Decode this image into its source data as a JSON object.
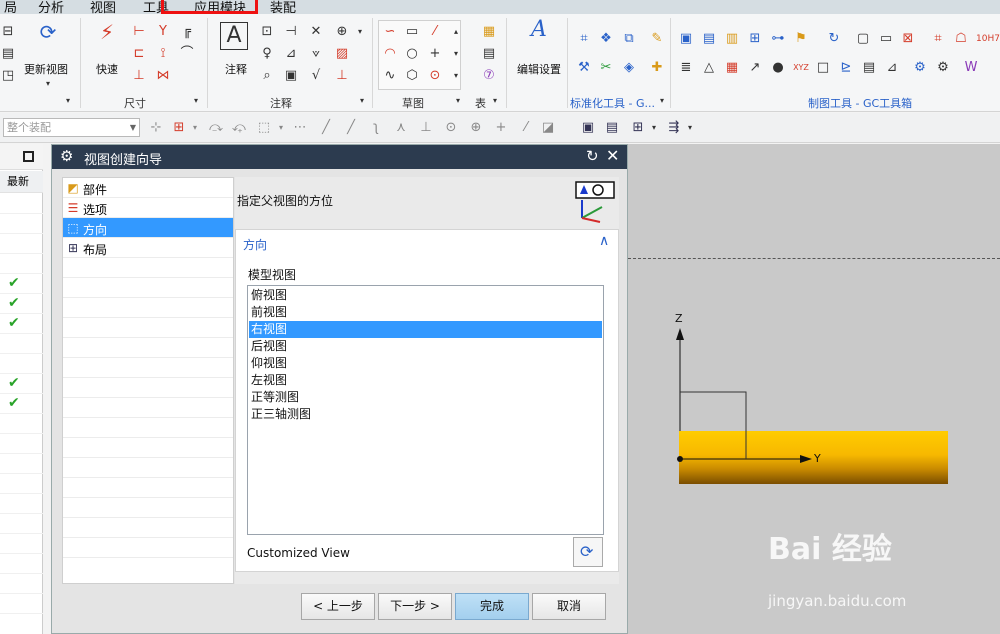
{
  "menu": {
    "items": [
      "局",
      "分析",
      "视图",
      "工具",
      "应用模块",
      "装配"
    ]
  },
  "ribbon": {
    "update_view_label": "更新视图",
    "quick_label": "快速",
    "dim_group_label": "尺寸",
    "note_label": "注释",
    "annot_group_label": "注释",
    "sketch_group_label": "草图",
    "table_group_label": "表",
    "edit_settings_label": "编辑设置",
    "std_tools_label": "标准化工具 - G...",
    "drafting_tools_label": "制图工具 - GC工具箱"
  },
  "selbar": {
    "assembly_placeholder": "整个装配"
  },
  "left_panel": {
    "latest_label": "最新",
    "checks": [
      true,
      true,
      true,
      false,
      false,
      true,
      true
    ]
  },
  "dialog": {
    "title": "视图创建向导",
    "steps": [
      {
        "label": "部件",
        "icon": "part-icon"
      },
      {
        "label": "选项",
        "icon": "options-icon"
      },
      {
        "label": "方向",
        "icon": "orientation-icon",
        "active": true
      },
      {
        "label": "布局",
        "icon": "layout-icon"
      }
    ],
    "spec_label": "指定父视图的方位",
    "group_title": "方向",
    "model_view_label": "模型视图",
    "model_views": [
      "俯视图",
      "前视图",
      "右视图",
      "后视图",
      "仰视图",
      "左视图",
      "正等测图",
      "正三轴测图"
    ],
    "selected_view": "右视图",
    "custom_view_label": "Customized View",
    "buttons": {
      "back": "< 上一步",
      "next": "下一步 >",
      "finish": "完成",
      "cancel": "取消"
    }
  },
  "graphics": {
    "axis_z": "Z",
    "axis_y": "Y",
    "watermark_brand": "Bai 经验",
    "watermark_url": "jingyan.baidu.com"
  },
  "colors": {
    "title_bar": "#2c3b4f",
    "selection": "#3399ff",
    "accent_blue": "#2a62c9",
    "solid_top": "#ffcc00",
    "solid_bottom": "#7a4d00",
    "highlight_red": "#e11111"
  }
}
